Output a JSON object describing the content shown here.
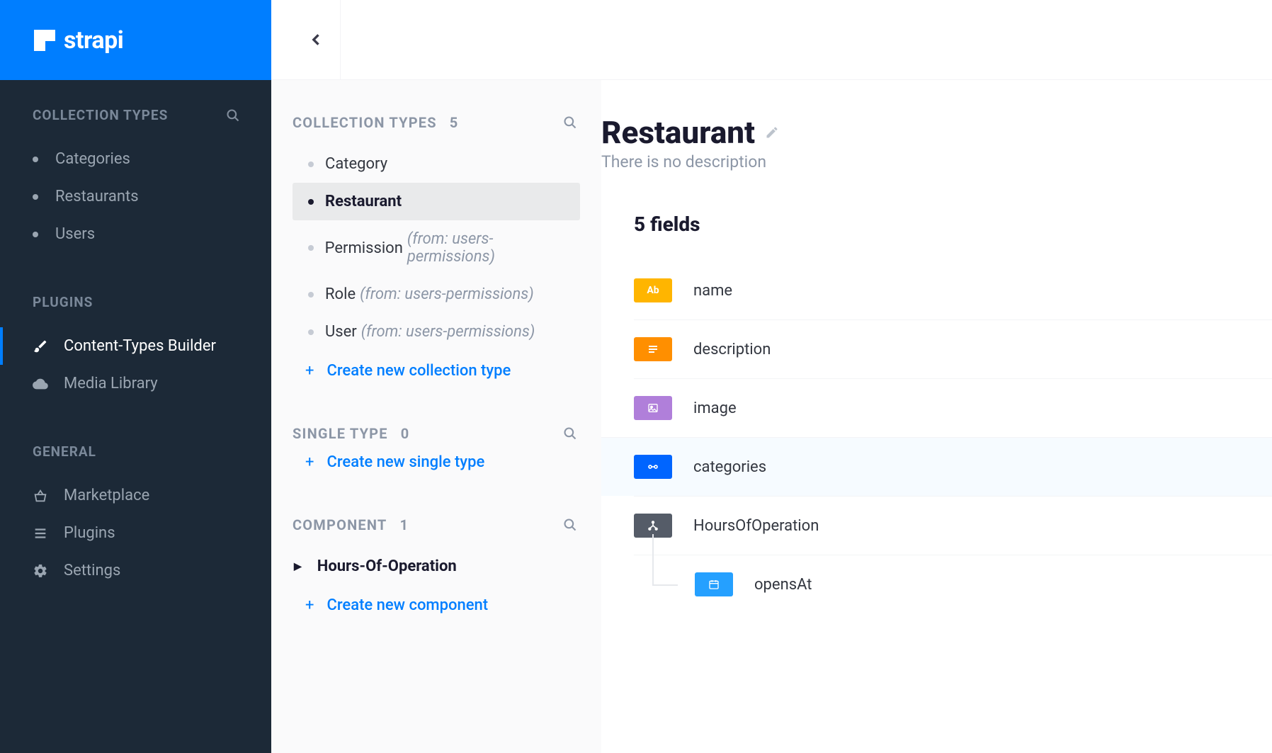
{
  "brand": "strapi",
  "sidebar": {
    "collection_header": "COLLECTION TYPES",
    "collection_items": [
      "Categories",
      "Restaurants",
      "Users"
    ],
    "plugins_header": "PLUGINS",
    "plugins_items": [
      {
        "label": "Content-Types Builder",
        "active": true,
        "icon": "brush"
      },
      {
        "label": "Media Library",
        "active": false,
        "icon": "cloud"
      }
    ],
    "general_header": "GENERAL",
    "general_items": [
      {
        "label": "Marketplace",
        "icon": "basket"
      },
      {
        "label": "Plugins",
        "icon": "list"
      },
      {
        "label": "Settings",
        "icon": "gear"
      }
    ]
  },
  "middle": {
    "collection": {
      "header": "COLLECTION TYPES",
      "count": "5",
      "create": "Create new collection type"
    },
    "collection_items": [
      {
        "label": "Category",
        "from": "",
        "active": false
      },
      {
        "label": "Restaurant",
        "from": "",
        "active": true
      },
      {
        "label": "Permission",
        "from": "(from: users-permissions)",
        "active": false
      },
      {
        "label": "Role",
        "from": "(from: users-permissions)",
        "active": false
      },
      {
        "label": "User",
        "from": "(from: users-permissions)",
        "active": false
      }
    ],
    "single": {
      "header": "SINGLE TYPE",
      "count": "0",
      "create": "Create new single type"
    },
    "component": {
      "header": "COMPONENT",
      "count": "1",
      "create": "Create new component"
    },
    "component_items": [
      "Hours-Of-Operation"
    ]
  },
  "right": {
    "title": "Restaurant",
    "description": "There is no description",
    "fields_header": "5 fields",
    "fields": [
      {
        "name": "name",
        "type": "text",
        "badge_text": "Ab"
      },
      {
        "name": "description",
        "type": "rich"
      },
      {
        "name": "image",
        "type": "media"
      },
      {
        "name": "categories",
        "type": "relation",
        "highlight": true
      },
      {
        "name": "HoursOfOperation",
        "type": "component"
      }
    ],
    "child_field": {
      "name": "opensAt",
      "type": "date"
    }
  }
}
